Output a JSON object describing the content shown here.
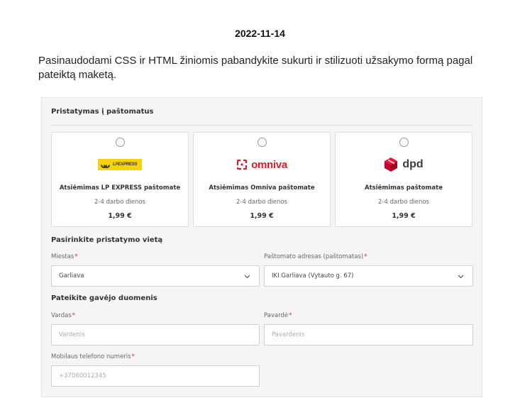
{
  "header": {
    "date": "2022-11-14",
    "intro": "Pasinaudodami CSS ir HTML žiniomis pabandykite sukurti ir stilizuoti užsakymo formą pagal pateiktą maketą."
  },
  "delivery": {
    "title": "Pristatymas į paštomatus",
    "options": [
      {
        "logo": "lp-express-logo",
        "logo_text": "LPEXPRESS",
        "name": "Atsiėmimas LP EXPRESS paštomate",
        "days": "2-4 darbo dienos",
        "price": "1,99 €",
        "selected": false
      },
      {
        "logo": "omniva-logo",
        "logo_text": "omniva",
        "name": "Atsiėmimas Omniva paštomate",
        "days": "2-4 darbo dienos",
        "price": "1,99 €",
        "selected": false
      },
      {
        "logo": "dpd-logo",
        "logo_text": "dpd",
        "name": "Atsiėmimas paštomate",
        "days": "2-4 darbo dienos",
        "price": "1,99 €",
        "selected": false
      }
    ]
  },
  "location": {
    "title": "Pasirinkite pristatymo vietą",
    "city_label": "Miestas",
    "city_value": "Garliava",
    "locker_label": "Paštomato adresas (paštomatas)",
    "locker_value": "IKI Garliava (Vytauto g. 67)"
  },
  "recipient": {
    "title": "Pateikite gavėjo duomenis",
    "first_name_label": "Vardas",
    "first_name_placeholder": "Vardenis",
    "last_name_label": "Pavardė",
    "last_name_placeholder": "Pavardenis",
    "phone_label": "Mobilaus telefono numeris",
    "phone_placeholder": "+37060012345"
  },
  "required_marker": "*",
  "colors": {
    "required": "#e0282f",
    "omniva": "#d6202c",
    "dpd": "#dc0032",
    "lp_express": "#f5d30a"
  }
}
